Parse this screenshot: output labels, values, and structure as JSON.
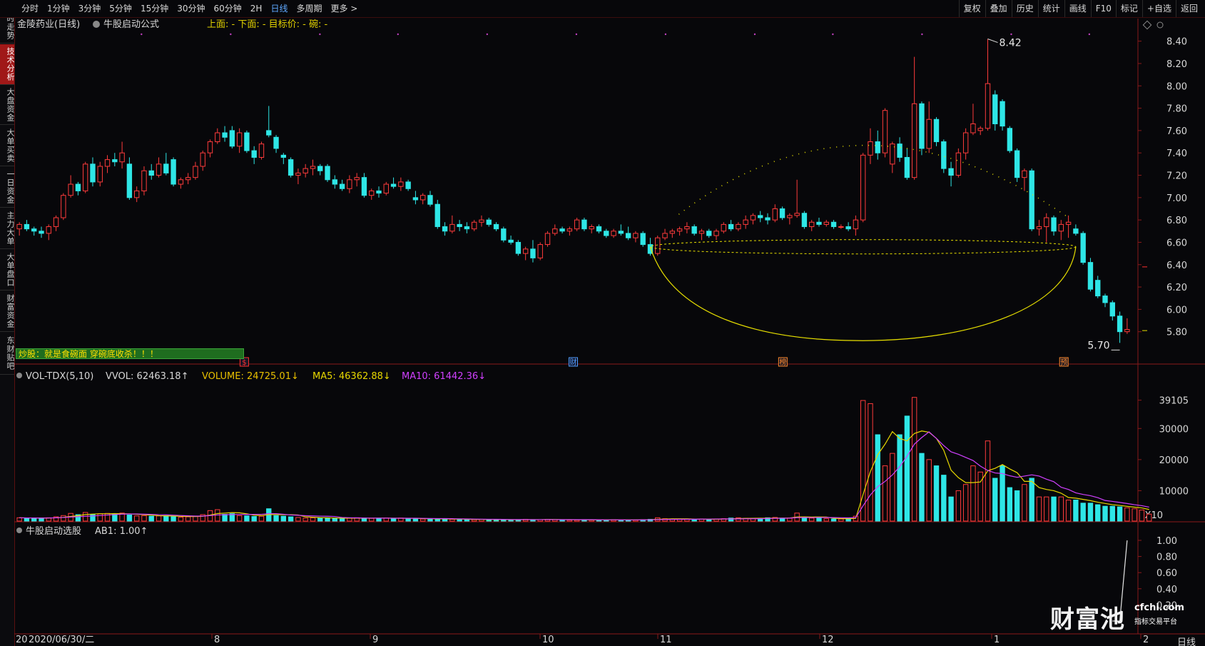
{
  "toolbar": {
    "periods": [
      "分时",
      "1分钟",
      "3分钟",
      "5分钟",
      "15分钟",
      "30分钟",
      "60分钟",
      "2H",
      "日线",
      "多周期",
      "更多 >"
    ],
    "active_period": "日线",
    "right": [
      "复权",
      "叠加",
      "历史",
      "统计",
      "画线",
      "F10",
      "标记",
      "+自选",
      "返回"
    ]
  },
  "sidetabs": [
    "分时走势",
    "技术分析",
    "大盘资金",
    "大单买卖",
    "一日资金",
    "主力大单",
    "大单盘口",
    "财富资金",
    "东财贴吧"
  ],
  "active_sidetab": "技术分析",
  "main_panel": {
    "stock_title": "金陵药业(日线)",
    "formula_name": "牛股启动公式",
    "formula_values": "上面: -   下面: -   目标价: -   碗: -",
    "y_ticks": [
      "8.40",
      "8.20",
      "8.00",
      "7.80",
      "7.60",
      "7.40",
      "7.20",
      "7.00",
      "6.80",
      "6.60",
      "6.40",
      "6.20",
      "6.00",
      "5.80"
    ],
    "high_label": "8.42",
    "low_label": "5.70",
    "banner": "炒股：就是食碗面 穿碗底收杀！！！",
    "markers": [
      {
        "text": "$",
        "color": "#ff3030"
      },
      {
        "text": "财",
        "color": "#4f9cff"
      },
      {
        "text": "榜",
        "color": "#ff8a2a"
      },
      {
        "text": "预",
        "color": "#ff8a2a"
      }
    ]
  },
  "volume_panel": {
    "title": "VOL-TDX(5,10)",
    "vvol": "VVOL: 62463.18↑",
    "volume": "VOLUME: 24725.01↓",
    "ma5": "MA5: 46362.88↓",
    "ma10": "MA10: 61442.36↓",
    "y_ticks": [
      "39105",
      "30000",
      "20000",
      "10000"
    ],
    "unit": "X10"
  },
  "indicator_panel": {
    "title": "牛股启动选股",
    "ab1": "AB1: 1.00↑",
    "y_ticks": [
      "1.00",
      "0.80",
      "0.60",
      "0.40",
      "0.20"
    ]
  },
  "x_axis": {
    "labels": [
      "20",
      "2020/06/30/二",
      "8",
      "9",
      "10",
      "11",
      "12",
      "1",
      "2"
    ],
    "period_label": "日线"
  },
  "watermark": {
    "brand": "财富池",
    "url": "cfchi.com",
    "tagline": "指标交易平台"
  },
  "chart_data": {
    "type": "candlestick",
    "ylim": [
      5.6,
      8.5
    ],
    "ohlc": [
      [
        6.72,
        6.78,
        6.66,
        6.76
      ],
      [
        6.76,
        6.8,
        6.7,
        6.72
      ],
      [
        6.72,
        6.74,
        6.66,
        6.7
      ],
      [
        6.7,
        6.74,
        6.64,
        6.68
      ],
      [
        6.68,
        6.76,
        6.62,
        6.74
      ],
      [
        6.74,
        6.84,
        6.7,
        6.82
      ],
      [
        6.82,
        7.04,
        6.8,
        7.02
      ],
      [
        7.02,
        7.2,
        7.0,
        7.12
      ],
      [
        7.12,
        7.14,
        7.02,
        7.06
      ],
      [
        7.06,
        7.32,
        7.04,
        7.3
      ],
      [
        7.3,
        7.36,
        7.1,
        7.14
      ],
      [
        7.14,
        7.32,
        7.1,
        7.28
      ],
      [
        7.28,
        7.38,
        7.22,
        7.34
      ],
      [
        7.34,
        7.4,
        7.28,
        7.32
      ],
      [
        7.32,
        7.5,
        7.26,
        7.4
      ],
      [
        7.3,
        7.36,
        6.98,
        7.0
      ],
      [
        7.0,
        7.1,
        6.96,
        7.06
      ],
      [
        7.06,
        7.28,
        7.02,
        7.24
      ],
      [
        7.24,
        7.3,
        7.16,
        7.2
      ],
      [
        7.2,
        7.36,
        7.18,
        7.3
      ],
      [
        7.3,
        7.4,
        7.2,
        7.22
      ],
      [
        7.34,
        7.36,
        7.1,
        7.12
      ],
      [
        7.12,
        7.18,
        7.08,
        7.16
      ],
      [
        7.16,
        7.22,
        7.12,
        7.18
      ],
      [
        7.18,
        7.32,
        7.16,
        7.28
      ],
      [
        7.28,
        7.42,
        7.24,
        7.4
      ],
      [
        7.4,
        7.52,
        7.36,
        7.5
      ],
      [
        7.5,
        7.62,
        7.48,
        7.58
      ],
      [
        7.58,
        7.64,
        7.5,
        7.54
      ],
      [
        7.6,
        7.64,
        7.44,
        7.46
      ],
      [
        7.46,
        7.62,
        7.4,
        7.58
      ],
      [
        7.58,
        7.6,
        7.4,
        7.42
      ],
      [
        7.42,
        7.46,
        7.3,
        7.36
      ],
      [
        7.36,
        7.5,
        7.34,
        7.48
      ],
      [
        7.6,
        7.82,
        7.54,
        7.56
      ],
      [
        7.54,
        7.56,
        7.4,
        7.44
      ],
      [
        7.38,
        7.4,
        7.3,
        7.36
      ],
      [
        7.34,
        7.36,
        7.18,
        7.2
      ],
      [
        7.2,
        7.26,
        7.12,
        7.22
      ],
      [
        7.22,
        7.3,
        7.18,
        7.26
      ],
      [
        7.26,
        7.34,
        7.2,
        7.28
      ],
      [
        7.28,
        7.3,
        7.2,
        7.24
      ],
      [
        7.28,
        7.3,
        7.14,
        7.16
      ],
      [
        7.16,
        7.2,
        7.08,
        7.12
      ],
      [
        7.12,
        7.16,
        7.06,
        7.08
      ],
      [
        7.08,
        7.2,
        7.04,
        7.16
      ],
      [
        7.16,
        7.22,
        7.1,
        7.18
      ],
      [
        7.18,
        7.22,
        7.0,
        7.02
      ],
      [
        7.02,
        7.08,
        6.98,
        7.06
      ],
      [
        7.06,
        7.1,
        7.0,
        7.04
      ],
      [
        7.04,
        7.14,
        7.02,
        7.12
      ],
      [
        7.12,
        7.18,
        7.08,
        7.1
      ],
      [
        7.1,
        7.18,
        7.06,
        7.14
      ],
      [
        7.14,
        7.16,
        7.06,
        7.08
      ],
      [
        7.0,
        7.06,
        6.94,
        6.98
      ],
      [
        6.98,
        7.04,
        6.94,
        7.02
      ],
      [
        7.02,
        7.06,
        6.92,
        6.94
      ],
      [
        6.94,
        6.98,
        6.72,
        6.74
      ],
      [
        6.74,
        6.78,
        6.66,
        6.7
      ],
      [
        6.7,
        6.84,
        6.68,
        6.76
      ],
      [
        6.76,
        6.8,
        6.7,
        6.74
      ],
      [
        6.74,
        6.78,
        6.68,
        6.72
      ],
      [
        6.72,
        6.8,
        6.7,
        6.78
      ],
      [
        6.78,
        6.84,
        6.74,
        6.8
      ],
      [
        6.8,
        6.82,
        6.74,
        6.76
      ],
      [
        6.76,
        6.78,
        6.7,
        6.72
      ],
      [
        6.72,
        6.74,
        6.6,
        6.62
      ],
      [
        6.62,
        6.66,
        6.58,
        6.6
      ],
      [
        6.6,
        6.62,
        6.48,
        6.5
      ],
      [
        6.5,
        6.56,
        6.44,
        6.54
      ],
      [
        6.54,
        6.62,
        6.42,
        6.46
      ],
      [
        6.46,
        6.6,
        6.44,
        6.58
      ],
      [
        6.58,
        6.7,
        6.56,
        6.68
      ],
      [
        6.68,
        6.76,
        6.66,
        6.72
      ],
      [
        6.72,
        6.74,
        6.68,
        6.7
      ],
      [
        6.7,
        6.74,
        6.66,
        6.72
      ],
      [
        6.72,
        6.82,
        6.7,
        6.8
      ],
      [
        6.8,
        6.82,
        6.7,
        6.72
      ],
      [
        6.72,
        6.76,
        6.68,
        6.74
      ],
      [
        6.74,
        6.76,
        6.68,
        6.7
      ],
      [
        6.7,
        6.72,
        6.64,
        6.66
      ],
      [
        6.66,
        6.72,
        6.64,
        6.7
      ],
      [
        6.7,
        6.76,
        6.66,
        6.68
      ],
      [
        6.68,
        6.74,
        6.62,
        6.64
      ],
      [
        6.64,
        6.7,
        6.6,
        6.68
      ],
      [
        6.68,
        6.7,
        6.56,
        6.58
      ],
      [
        6.58,
        6.64,
        6.48,
        6.5
      ],
      [
        6.5,
        6.66,
        6.48,
        6.64
      ],
      [
        6.64,
        6.72,
        6.62,
        6.68
      ],
      [
        6.68,
        6.72,
        6.64,
        6.7
      ],
      [
        6.7,
        6.74,
        6.66,
        6.72
      ],
      [
        6.72,
        6.78,
        6.68,
        6.74
      ],
      [
        6.74,
        6.76,
        6.66,
        6.68
      ],
      [
        6.68,
        6.72,
        6.62,
        6.7
      ],
      [
        6.7,
        6.72,
        6.64,
        6.66
      ],
      [
        6.66,
        6.72,
        6.62,
        6.7
      ],
      [
        6.7,
        6.78,
        6.68,
        6.76
      ],
      [
        6.76,
        6.8,
        6.7,
        6.72
      ],
      [
        6.72,
        6.78,
        6.7,
        6.76
      ],
      [
        6.76,
        6.84,
        6.72,
        6.8
      ],
      [
        6.8,
        6.86,
        6.76,
        6.84
      ],
      [
        6.84,
        6.88,
        6.78,
        6.82
      ],
      [
        6.82,
        6.86,
        6.76,
        6.8
      ],
      [
        6.8,
        6.94,
        6.78,
        6.9
      ],
      [
        6.9,
        6.92,
        6.8,
        6.82
      ],
      [
        6.82,
        6.86,
        6.76,
        6.84
      ],
      [
        6.84,
        7.16,
        6.82,
        6.86
      ],
      [
        6.86,
        6.88,
        6.72,
        6.74
      ],
      [
        6.74,
        6.8,
        6.7,
        6.78
      ],
      [
        6.78,
        6.82,
        6.74,
        6.76
      ],
      [
        6.76,
        6.8,
        6.74,
        6.78
      ],
      [
        6.78,
        6.8,
        6.72,
        6.74
      ],
      [
        6.74,
        6.76,
        6.72,
        6.74
      ],
      [
        6.74,
        6.78,
        6.7,
        6.72
      ],
      [
        6.72,
        6.84,
        6.66,
        6.8
      ],
      [
        6.8,
        7.4,
        6.78,
        7.38
      ],
      [
        7.38,
        7.62,
        7.3,
        7.5
      ],
      [
        7.5,
        7.6,
        7.34,
        7.4
      ],
      [
        7.4,
        7.8,
        7.36,
        7.78
      ],
      [
        7.3,
        7.5,
        7.22,
        7.48
      ],
      [
        7.48,
        7.54,
        7.32,
        7.36
      ],
      [
        7.36,
        7.44,
        7.16,
        7.18
      ],
      [
        7.18,
        8.26,
        7.16,
        7.84
      ],
      [
        7.84,
        7.86,
        7.38,
        7.44
      ],
      [
        7.44,
        7.86,
        7.4,
        7.7
      ],
      [
        7.7,
        7.72,
        7.46,
        7.5
      ],
      [
        7.5,
        7.52,
        7.22,
        7.26
      ],
      [
        7.26,
        7.32,
        7.1,
        7.2
      ],
      [
        7.2,
        7.44,
        7.18,
        7.4
      ],
      [
        7.4,
        7.62,
        7.34,
        7.58
      ],
      [
        7.58,
        7.84,
        7.56,
        7.66
      ],
      [
        7.6,
        7.64,
        7.56,
        7.62
      ],
      [
        7.62,
        8.42,
        7.6,
        8.02
      ],
      [
        7.92,
        7.96,
        7.6,
        7.66
      ],
      [
        7.86,
        7.88,
        7.6,
        7.64
      ],
      [
        7.62,
        7.64,
        7.4,
        7.42
      ],
      [
        7.42,
        7.44,
        7.14,
        7.18
      ],
      [
        7.18,
        7.26,
        7.06,
        7.24
      ],
      [
        7.24,
        7.26,
        6.7,
        6.72
      ],
      [
        6.72,
        6.8,
        6.66,
        6.74
      ],
      [
        6.74,
        6.86,
        6.6,
        6.82
      ],
      [
        6.82,
        6.84,
        6.66,
        6.7
      ],
      [
        6.7,
        6.8,
        6.62,
        6.76
      ],
      [
        6.76,
        6.84,
        6.64,
        6.78
      ],
      [
        6.72,
        6.76,
        6.66,
        6.68
      ],
      [
        6.68,
        6.7,
        6.4,
        6.42
      ],
      [
        6.42,
        6.46,
        6.16,
        6.18
      ],
      [
        6.26,
        6.3,
        6.1,
        6.12
      ],
      [
        6.12,
        6.14,
        6.02,
        6.06
      ],
      [
        6.06,
        6.08,
        5.9,
        5.94
      ],
      [
        5.94,
        5.98,
        5.7,
        5.8
      ],
      [
        5.8,
        5.92,
        5.78,
        5.82
      ]
    ],
    "volume": [
      1.3,
      1.2,
      1.2,
      1.1,
      1.3,
      1.6,
      2.0,
      2.7,
      2.3,
      3.0,
      2.4,
      2.6,
      2.7,
      2.5,
      2.8,
      2.2,
      1.9,
      2.0,
      1.8,
      1.9,
      1.9,
      1.7,
      1.5,
      1.6,
      1.8,
      2.3,
      3.6,
      3.9,
      2.4,
      2.6,
      2.0,
      1.9,
      1.7,
      1.8,
      4.2,
      2.0,
      1.8,
      1.6,
      1.4,
      1.2,
      1.3,
      1.2,
      1.3,
      1.1,
      1.0,
      1.2,
      1.3,
      1.2,
      1.1,
      1.1,
      1.2,
      1.1,
      1.2,
      1.0,
      1.0,
      0.9,
      0.9,
      1.0,
      0.9,
      0.8,
      0.8,
      0.7,
      0.7,
      0.8,
      0.7,
      0.7,
      0.6,
      0.6,
      0.7,
      0.8,
      0.7,
      0.7,
      0.8,
      0.7,
      0.6,
      0.6,
      0.6,
      0.7,
      0.6,
      0.6,
      0.6,
      0.7,
      0.6,
      0.6,
      0.6,
      0.7,
      0.8,
      1.3,
      1.0,
      0.9,
      0.8,
      0.8,
      0.8,
      0.9,
      0.8,
      0.9,
      1.0,
      1.2,
      1.3,
      1.1,
      1.0,
      1.1,
      1.3,
      1.4,
      1.1,
      1.2,
      2.8,
      1.4,
      1.2,
      1.2,
      1.0,
      0.9,
      0.9,
      1.0,
      1.8,
      39.0,
      38.0,
      28.0,
      18.0,
      22.0,
      28.0,
      34.0,
      40.0,
      22.0,
      20.0,
      18.0,
      15.0,
      8.0,
      10.0,
      12.0,
      18.0,
      16.0,
      26.0,
      14.0,
      18.0,
      11.0,
      10.0,
      12.0,
      14.0,
      8.0,
      8.0,
      8.0,
      8.0,
      7.0,
      7.0,
      6.0,
      6.0,
      5.5,
      5.0,
      5.0,
      4.8,
      4.5,
      4.2,
      3.8,
      2.47
    ]
  }
}
